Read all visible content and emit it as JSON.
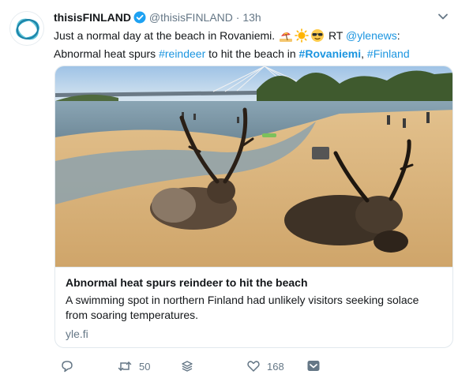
{
  "tweet": {
    "display_name": "thisisFINLAND",
    "handle": "@thisisFINLAND",
    "separator": "·",
    "time": "13h",
    "text_part1": "Just a normal day at the beach in Rovaniemi.",
    "text_part2": "RT",
    "mention": "@ylenews",
    "text_part3": ": Abnormal heat spurs",
    "hashtag_reindeer": "#reindeer",
    "text_part4": "to hit the beach in",
    "hashtag_rovaniemi": "#Rovaniemi",
    "text_part5": ",",
    "hashtag_finland": "#Finland",
    "emojis": [
      "beach-with-umbrella-emoji",
      "sun-emoji",
      "sunglasses-emoji"
    ]
  },
  "card": {
    "title": "Abnormal heat spurs reindeer to hit the beach",
    "description": "A swimming spot in northern Finland had unlikely visitors seeking solace from soaring temperatures.",
    "domain": "yle.fi"
  },
  "actions": {
    "reply_count": "",
    "retweet_count": "50",
    "like_count": "168"
  },
  "colors": {
    "link": "#1b95e0",
    "muted": "#657786",
    "verified": "#1da1f2"
  }
}
